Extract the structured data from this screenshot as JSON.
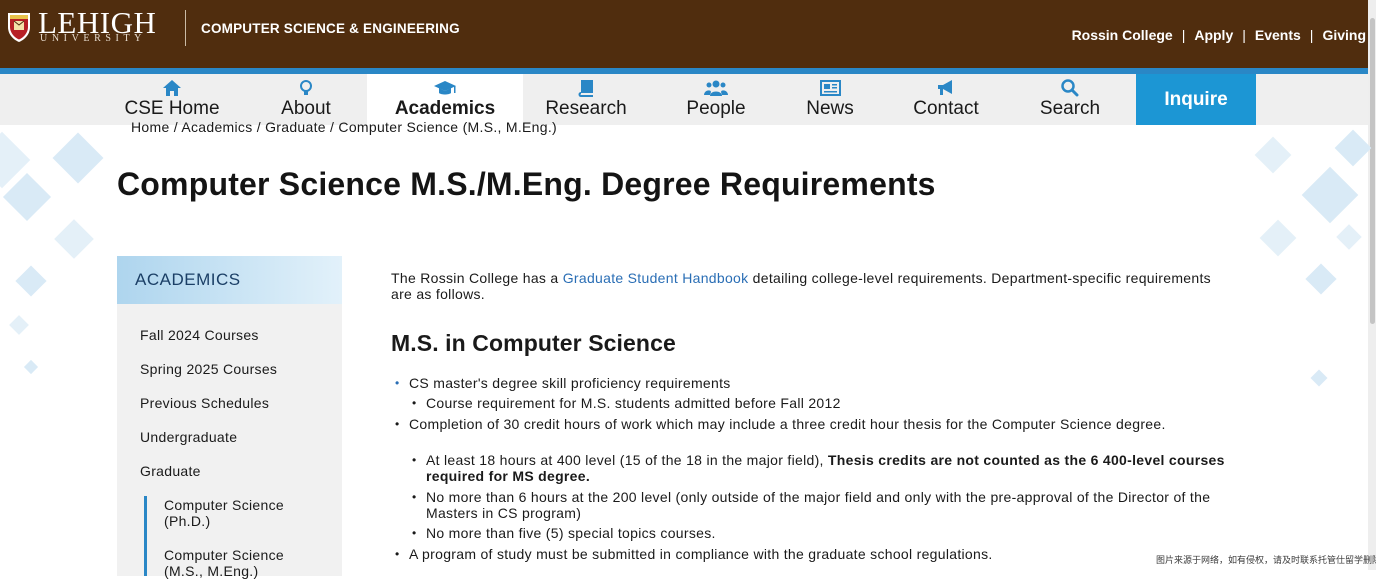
{
  "header": {
    "logo_main": "LEHIGH",
    "logo_sub": "UNIVERSITY",
    "department": "COMPUTER SCIENCE & ENGINEERING",
    "utility_links": [
      "Rossin College",
      "Apply",
      "Events",
      "Giving"
    ],
    "separator": "|"
  },
  "nav": {
    "items": [
      {
        "label": "CSE Home",
        "icon": "home-icon"
      },
      {
        "label": "About",
        "icon": "lightbulb-icon"
      },
      {
        "label": "Academics",
        "icon": "graduation-cap-icon",
        "active": true
      },
      {
        "label": "Research",
        "icon": "book-icon"
      },
      {
        "label": "People",
        "icon": "users-icon"
      },
      {
        "label": "News",
        "icon": "newspaper-icon"
      },
      {
        "label": "Contact",
        "icon": "bullhorn-icon"
      },
      {
        "label": "Search",
        "icon": "search-icon"
      }
    ],
    "inquire_label": "Inquire"
  },
  "breadcrumb": {
    "text": "Home / Academics / Graduate / Computer Science (M.S., M.Eng.)"
  },
  "page_title": "Computer Science M.S./M.Eng. Degree Requirements",
  "sidebar": {
    "heading": "ACADEMICS",
    "items": [
      "Fall 2024 Courses",
      "Spring 2025 Courses",
      "Previous Schedules",
      "Undergraduate",
      "Graduate"
    ],
    "subitems": [
      "Computer Science (Ph.D.)",
      "Computer Science (M.S., M.Eng.)"
    ]
  },
  "main": {
    "intro_before": "The Rossin College has a ",
    "intro_link": "Graduate Student Handbook",
    "intro_after": " detailing college-level requirements.  Department-specific requirements are as follows.",
    "section_title": "M.S. in Computer Science",
    "list": {
      "item1_link": "CS master's degree skill proficiency requirements",
      "item1_sub_link": "Course requirement for M.S. students admitted before Fall 2012",
      "item2": "Completion of 30 credit hours of work which may include a three credit hour thesis for the Computer Science degree.",
      "item2_sub1_plain": "At least 18 hours at 400 level (15 of the 18 in the major field),  ",
      "item2_sub1_bold": "Thesis credits are not counted as the 6 400-level courses required for MS degree.",
      "item2_sub2": "No more than 6 hours at the 200 level (only outside of the major field and only with the pre-approval of the Director of the Masters in CS  program)",
      "item2_sub3": "No more than five (5) special topics courses.",
      "item3": "A program of study must be submitted in compliance with the graduate school regulations."
    }
  },
  "watermark": "图片来源于网络，如有侵权，请及时联系托管仕留学删除",
  "colors": {
    "header_bg": "#502d0e",
    "accent_blue": "#2a87c6",
    "inquire_bg": "#1c96d4",
    "link": "#2a6eb5"
  }
}
